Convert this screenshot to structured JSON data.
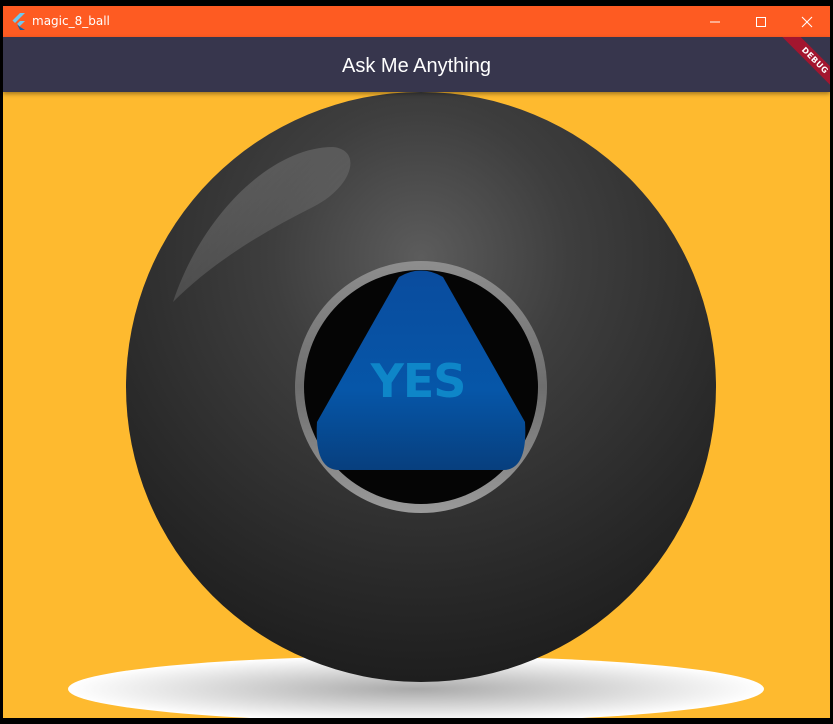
{
  "window": {
    "title": "magic_8_ball",
    "titlebar_color": "#FE5B22",
    "icon": "flutter-icon",
    "controls": [
      "minimize-icon",
      "maximize-icon",
      "close-icon"
    ]
  },
  "appbar": {
    "title": "Ask Me Anything",
    "color": "#37364D"
  },
  "debug_banner": {
    "label": "DEBUG",
    "color": "#A3162F"
  },
  "content": {
    "background_color": "#FEBA2F",
    "ball_answer": "YES",
    "answer_color": "#0E86C8",
    "ball_icon": "magic-8-ball-image"
  }
}
